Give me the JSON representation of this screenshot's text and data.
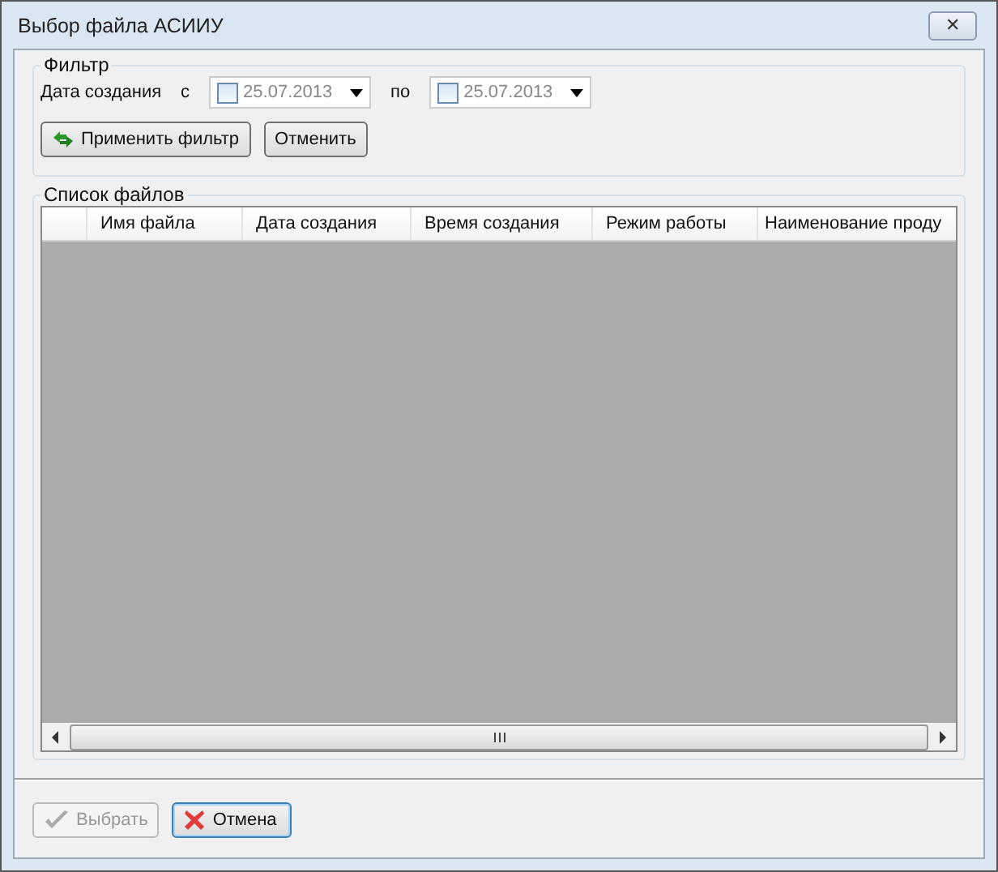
{
  "window": {
    "title": "Выбор файла АСИИУ",
    "close": "✕"
  },
  "filter": {
    "title": "Фильтр",
    "label": "Дата создания",
    "from": {
      "prefix": "с",
      "checked": false,
      "value": "25.07.2013"
    },
    "to": {
      "prefix": "по",
      "checked": false,
      "value": "25.07.2013"
    },
    "buttons": [
      {
        "kind": "apply",
        "label": "Применить фильтр"
      },
      {
        "kind": "plain",
        "label": "Отменить"
      }
    ]
  },
  "files": {
    "title": "Список файлов",
    "columns": [
      "Имя файла",
      "Дата создания",
      "Время создания",
      "Режим работы",
      "Наименование проду"
    ]
  },
  "footer": [
    {
      "kind": "ok",
      "label": "Выбрать",
      "disabled": true,
      "focused": false
    },
    {
      "kind": "cancel",
      "label": "Отмена",
      "disabled": false,
      "focused": true
    }
  ]
}
